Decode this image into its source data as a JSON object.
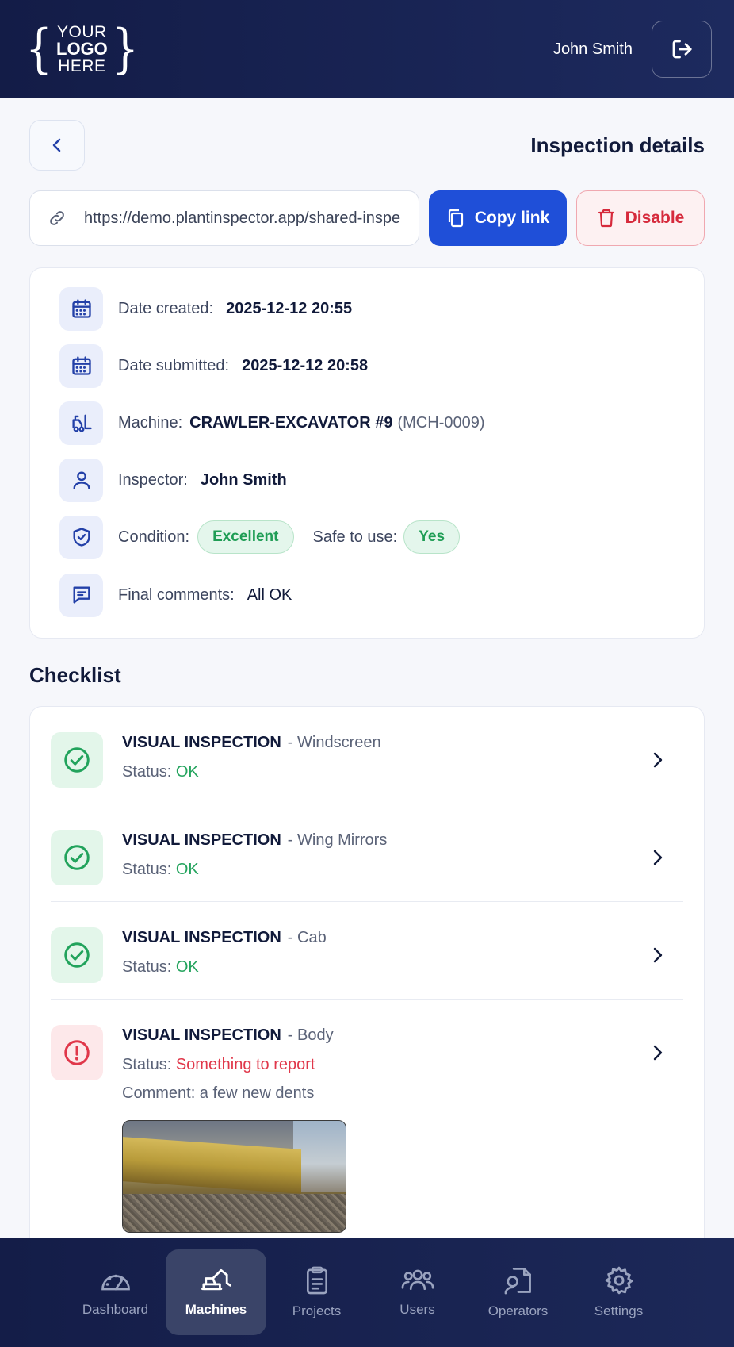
{
  "header": {
    "logo": {
      "line1": "YOUR",
      "line2": "LOGO",
      "line3": "HERE"
    },
    "user_name": "John Smith",
    "logout_icon": "logout-icon"
  },
  "page": {
    "title": "Inspection details"
  },
  "share": {
    "link_value": "https://demo.plantinspector.app/shared-inspection",
    "copy_label": "Copy link",
    "disable_label": "Disable"
  },
  "details": {
    "date_created_label": "Date created:",
    "date_created": "2025-12-12 20:55",
    "date_submitted_label": "Date submitted:",
    "date_submitted": "2025-12-12 20:58",
    "machine_label": "Machine:",
    "machine_name": "CRAWLER-EXCAVATOR #9",
    "machine_code": "(MCH-0009)",
    "inspector_label": "Inspector:",
    "inspector": "John Smith",
    "condition_label": "Condition:",
    "condition": "Excellent",
    "safe_label": "Safe to use:",
    "safe": "Yes",
    "comments_label": "Final comments:",
    "comments": "All OK"
  },
  "checklist": {
    "title": "Checklist",
    "status_prefix": "Status:",
    "items": [
      {
        "category": "VISUAL INSPECTION",
        "part": "- Windscreen",
        "status": "OK"
      },
      {
        "category": "VISUAL INSPECTION",
        "part": "- Wing Mirrors",
        "status": "OK"
      },
      {
        "category": "VISUAL INSPECTION",
        "part": "- Cab",
        "status": "OK"
      },
      {
        "category": "VISUAL INSPECTION",
        "part": "- Body",
        "status": "Something to report",
        "comment": "Comment: a few new dents"
      }
    ]
  },
  "colors": {
    "primary": "#1f4fd8",
    "danger": "#d62a3c",
    "success": "#22a35c",
    "nav_bg": "#141d48"
  },
  "nav": {
    "items": [
      {
        "label": "Dashboard",
        "icon": "gauge-icon"
      },
      {
        "label": "Machines",
        "icon": "excavator-icon"
      },
      {
        "label": "Projects",
        "icon": "clipboard-icon"
      },
      {
        "label": "Users",
        "icon": "users-icon"
      },
      {
        "label": "Operators",
        "icon": "operator-icon"
      },
      {
        "label": "Settings",
        "icon": "gear-icon"
      }
    ],
    "active": "Machines"
  }
}
